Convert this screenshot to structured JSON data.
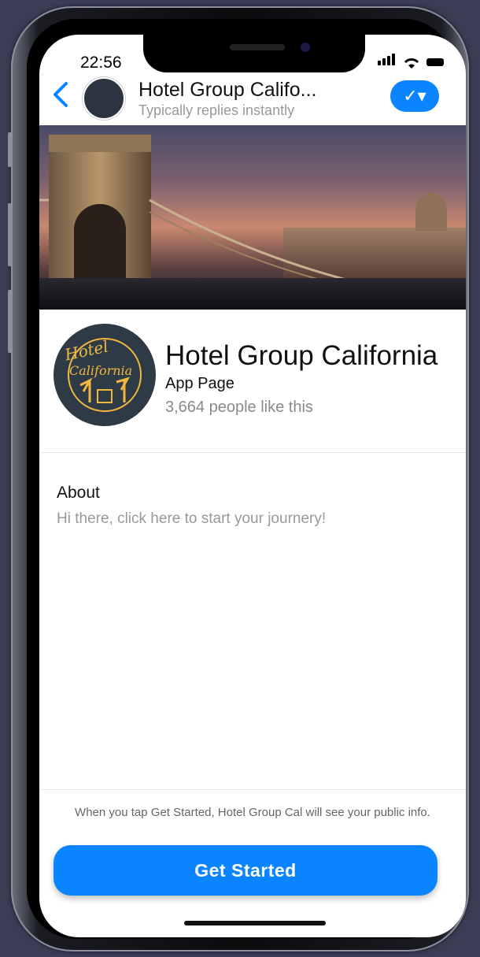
{
  "status_bar": {
    "time": "22:56"
  },
  "header": {
    "title": "Hotel Group Califo...",
    "subtitle": "Typically replies instantly",
    "back_icon": "chevron-left-icon",
    "action_icon": "checkmark-dropdown-icon",
    "action_label": "✓▾"
  },
  "profile": {
    "name": "Hotel Group California",
    "type": "App Page",
    "likes": "3,664 people like this",
    "logo_text_line1": "Hotel",
    "logo_text_line2": "California"
  },
  "about": {
    "label": "About",
    "text": "Hi there, click here to start your journery!"
  },
  "footer": {
    "notice": "When you tap Get Started, Hotel Group Cal will see your public info.",
    "cta_label": "Get Started"
  },
  "colors": {
    "accent": "#0a84ff",
    "background": "#3b3d55"
  }
}
